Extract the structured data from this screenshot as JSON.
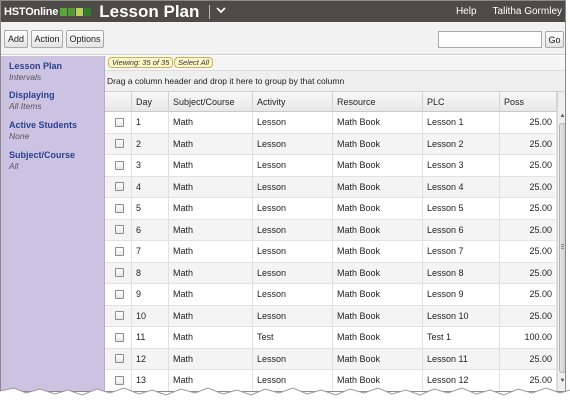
{
  "app": {
    "logo_text": "HSTOnline",
    "logo_colors": [
      "#5aa63c",
      "#4f9a32",
      "#b9d05a",
      "#2f7e2a"
    ],
    "title": "Lesson Plan",
    "help_label": "Help",
    "user_name": "Talitha Gormley"
  },
  "toolbar": {
    "add_label": "Add",
    "action_label": "Action",
    "options_label": "Options",
    "search_value": "",
    "go_label": "Go"
  },
  "sidebar": {
    "items": [
      {
        "label": "Lesson Plan",
        "value": "Intervals"
      },
      {
        "label": "Displaying",
        "value": "All Items"
      },
      {
        "label": "Active Students",
        "value": "None"
      },
      {
        "label": "Subject/Course",
        "value": "All"
      }
    ]
  },
  "grid": {
    "viewing_label": "Viewing: 35 of 35",
    "select_all_label": "Select All",
    "group_hint": "Drag a column header and drop it here to group by that column",
    "columns": [
      "",
      "Day",
      "Subject/Course",
      "Activity",
      "Resource",
      "PLC",
      "Poss"
    ],
    "rows": [
      {
        "day": "1",
        "subject": "Math",
        "activity": "Lesson",
        "resource": "Math Book",
        "plc": "Lesson 1",
        "poss": "25.00"
      },
      {
        "day": "2",
        "subject": "Math",
        "activity": "Lesson",
        "resource": "Math Book",
        "plc": "Lesson 2",
        "poss": "25.00"
      },
      {
        "day": "3",
        "subject": "Math",
        "activity": "Lesson",
        "resource": "Math Book",
        "plc": "Lesson 3",
        "poss": "25.00"
      },
      {
        "day": "4",
        "subject": "Math",
        "activity": "Lesson",
        "resource": "Math Book",
        "plc": "Lesson 4",
        "poss": "25.00"
      },
      {
        "day": "5",
        "subject": "Math",
        "activity": "Lesson",
        "resource": "Math Book",
        "plc": "Lesson 5",
        "poss": "25.00"
      },
      {
        "day": "6",
        "subject": "Math",
        "activity": "Lesson",
        "resource": "Math Book",
        "plc": "Lesson 6",
        "poss": "25.00"
      },
      {
        "day": "7",
        "subject": "Math",
        "activity": "Lesson",
        "resource": "Math Book",
        "plc": "Lesson 7",
        "poss": "25.00"
      },
      {
        "day": "8",
        "subject": "Math",
        "activity": "Lesson",
        "resource": "Math Book",
        "plc": "Lesson 8",
        "poss": "25.00"
      },
      {
        "day": "9",
        "subject": "Math",
        "activity": "Lesson",
        "resource": "Math Book",
        "plc": "Lesson 9",
        "poss": "25.00"
      },
      {
        "day": "10",
        "subject": "Math",
        "activity": "Lesson",
        "resource": "Math Book",
        "plc": "Lesson 10",
        "poss": "25.00"
      },
      {
        "day": "11",
        "subject": "Math",
        "activity": "Test",
        "resource": "Math Book",
        "plc": "Test 1",
        "poss": "100.00"
      },
      {
        "day": "12",
        "subject": "Math",
        "activity": "Lesson",
        "resource": "Math Book",
        "plc": "Lesson 11",
        "poss": "25.00"
      },
      {
        "day": "13",
        "subject": "Math",
        "activity": "Lesson",
        "resource": "Math Book",
        "plc": "Lesson 12",
        "poss": "25.00"
      }
    ]
  },
  "colors": {
    "topbar": "#4e4a46",
    "sidebar": "#ccc3e3",
    "sidebar_label": "#2a3f8f"
  },
  "icons": {
    "title_menu": "chevron-down-icon",
    "scroll_up": "arrow-up-icon",
    "scroll_down": "arrow-down-icon",
    "row_select": "checkbox-icon"
  }
}
